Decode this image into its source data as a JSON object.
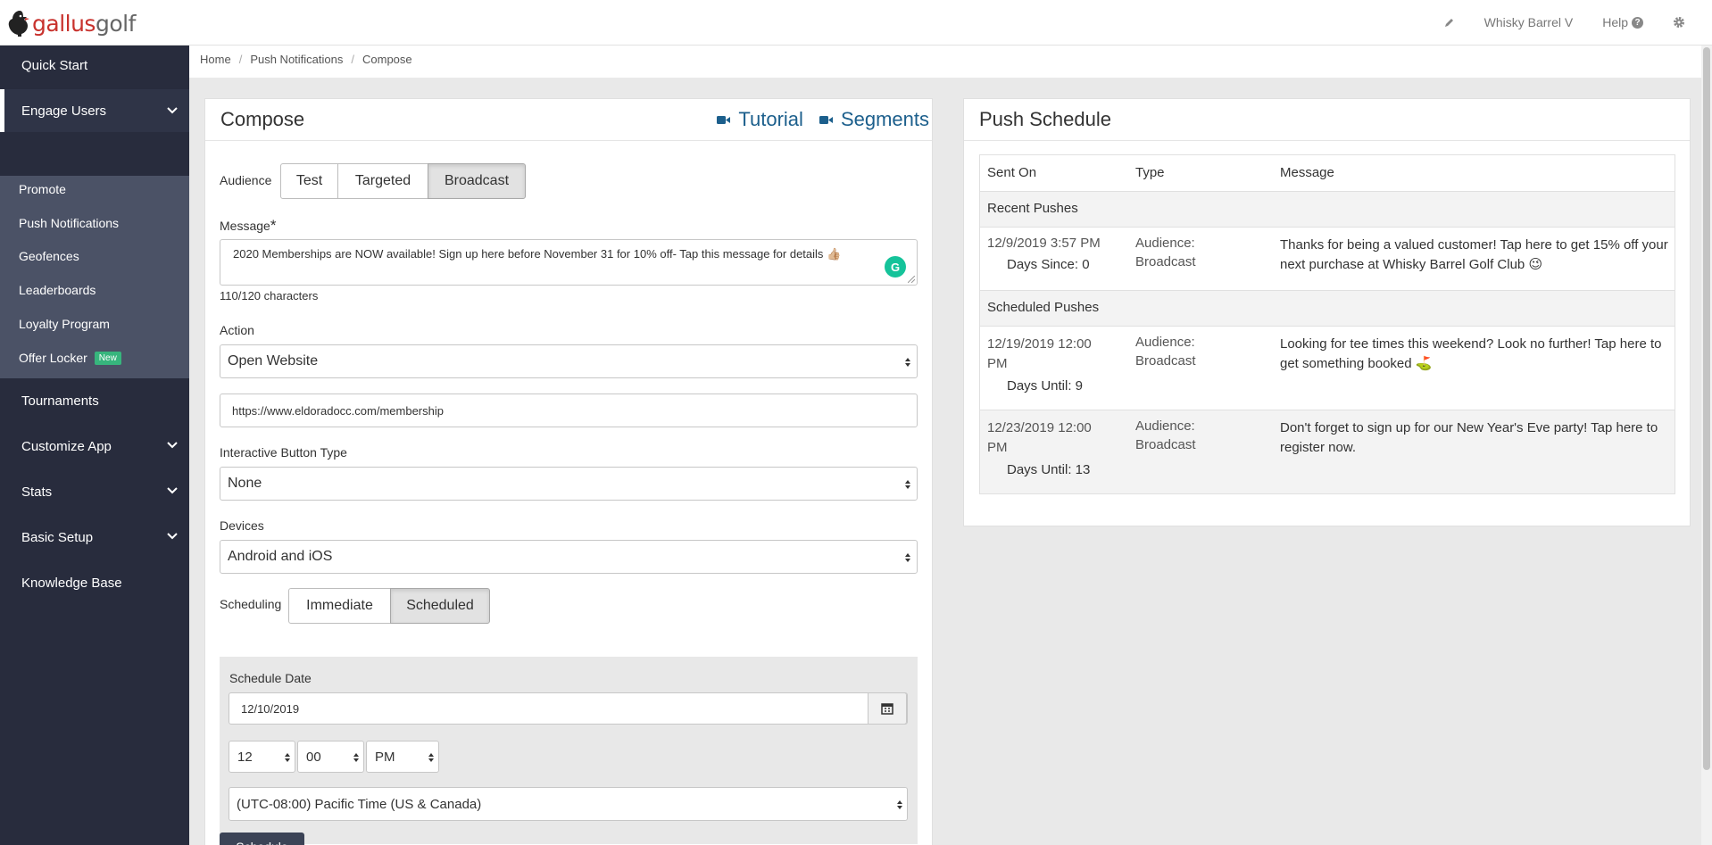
{
  "brand": {
    "name_part1": "gallus",
    "name_part2": "golf"
  },
  "topbar": {
    "club_name": "Whisky Barrel V",
    "help_label": "Help",
    "edit_icon": "pencil-icon",
    "settings_icon": "gear-icon",
    "help_icon": "question-circle-icon"
  },
  "sidebar": {
    "items": [
      {
        "label": "Quick Start"
      },
      {
        "label": "Engage Users"
      },
      {
        "label": "Tournaments"
      },
      {
        "label": "Customize App"
      },
      {
        "label": "Stats"
      },
      {
        "label": "Basic Setup"
      },
      {
        "label": "Knowledge Base"
      }
    ],
    "subitems": [
      {
        "label": "Promote"
      },
      {
        "label": "Push Notifications"
      },
      {
        "label": "Geofences"
      },
      {
        "label": "Leaderboards"
      },
      {
        "label": "Loyalty Program"
      },
      {
        "label": "Offer Locker"
      }
    ],
    "new_badge": "New"
  },
  "breadcrumb": [
    "Home",
    "Push Notifications",
    "Compose"
  ],
  "compose": {
    "title": "Compose",
    "tutorial": "Tutorial",
    "segments": "Segments",
    "audience_label": "Audience",
    "audience_options": [
      "Test",
      "Targeted",
      "Broadcast"
    ],
    "audience_selected": "Broadcast",
    "message_label": "Message",
    "required_mark": "*",
    "message_value": "2020 Memberships are NOW available! Sign up here before November 31 for 10% off- Tap this message for details 👍🏼",
    "char_count": "110/120 characters",
    "action_label": "Action",
    "action_value": "Open Website",
    "url_value": "https://www.eldoradocc.com/membership",
    "button_type_label": "Interactive Button Type",
    "button_type_value": "None",
    "devices_label": "Devices",
    "devices_value": "Android and iOS",
    "scheduling_label": "Scheduling",
    "scheduling_options": [
      "Immediate",
      "Scheduled"
    ],
    "scheduling_selected": "Scheduled",
    "schedule_date_label": "Schedule Date",
    "schedule_date_value": "12/10/2019",
    "hour": "12",
    "minute": "00",
    "ampm": "PM",
    "timezone": "(UTC-08:00) Pacific Time (US & Canada)",
    "schedule_button": "Schedule"
  },
  "push_schedule": {
    "title": "Push Schedule",
    "columns": [
      "Sent On",
      "Type",
      "Message"
    ],
    "recent_label": "Recent Pushes",
    "scheduled_label": "Scheduled Pushes",
    "recent": [
      {
        "date": "12/9/2019 3:57 PM",
        "days": "Days Since: 0",
        "type_line1": "Audience:",
        "type_line2": "Broadcast",
        "message": "Thanks for being a valued customer! Tap here to get 15% off your next purchase at Whisky Barrel Golf Club 😉"
      }
    ],
    "scheduled": [
      {
        "date": "12/19/2019 12:00 PM",
        "days": "Days Until: 9",
        "type_line1": "Audience:",
        "type_line2": "Broadcast",
        "message": "Looking for tee times this weekend? Look no further! Tap here to get something booked ⛳"
      },
      {
        "date": "12/23/2019 12:00 PM",
        "days": "Days Until: 13",
        "type_line1": "Audience:",
        "type_line2": "Broadcast",
        "message": "Don't forget to sign up for our New Year's Eve party! Tap here to register now."
      }
    ]
  }
}
